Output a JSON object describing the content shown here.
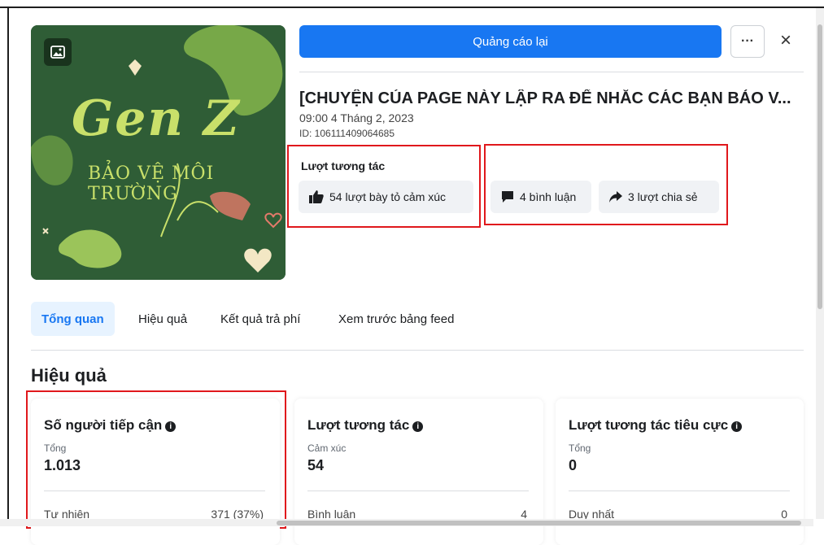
{
  "header": {
    "boost_button_label": "Quảng cáo lại",
    "more_label": "···",
    "close_label": "×"
  },
  "thumbnail": {
    "title_text": "Gen Z",
    "subtitle_text": "BẢO VỆ MÔI TRƯỜNG",
    "icon": "photo-icon"
  },
  "post": {
    "title": "[CHUYỆN CỦA PAGE NÀY LẬP RA ĐỂ NHẮC CÁC BẠN BẢO V...",
    "date": "09:00 4 Tháng 2, 2023",
    "id": "ID: 106111409064685"
  },
  "interactions": {
    "label": "Lượt tương tác",
    "reactions": "54 lượt bày tỏ cảm xúc",
    "comments": "4 bình luận",
    "shares": "3 lượt chia sẻ"
  },
  "tabs": [
    {
      "label": "Tổng quan",
      "active": true
    },
    {
      "label": "Hiệu quả",
      "active": false
    },
    {
      "label": "Kết quả trả phí",
      "active": false
    },
    {
      "label": "Xem trước bảng feed",
      "active": false
    }
  ],
  "section_title": "Hiệu quả",
  "cards": [
    {
      "title": "Số người tiếp cận",
      "sub": "Tổng",
      "value": "1.013",
      "row_label": "Tự nhiên",
      "row_value": "371 (37%)"
    },
    {
      "title": "Lượt tương tác",
      "sub": "Cảm xúc",
      "value": "54",
      "row_label": "Bình luận",
      "row_value": "4"
    },
    {
      "title": "Lượt tương tác tiêu cực",
      "sub": "Tổng",
      "value": "0",
      "row_label": "Duy nhất",
      "row_value": "0"
    }
  ],
  "colors": {
    "primary": "#1877f2",
    "highlight": "#e0181c",
    "thumb_bg": "#2f5d36",
    "thumb_text": "#c9e06a"
  }
}
